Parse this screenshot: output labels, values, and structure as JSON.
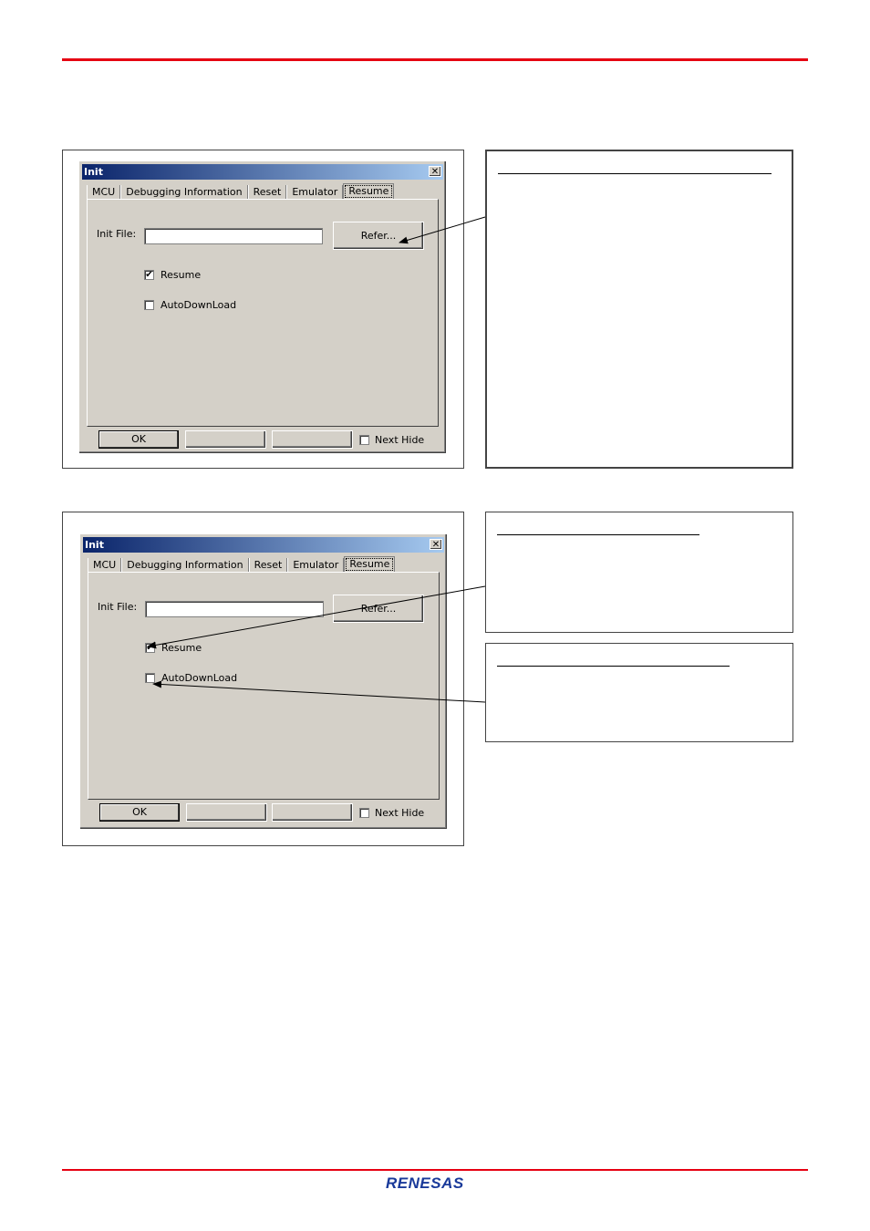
{
  "dialog1": {
    "title": "Init",
    "close_glyph": "✕",
    "tabs": [
      "MCU",
      "Debugging Information",
      "Reset",
      "Emulator",
      "Resume"
    ],
    "init_file_label": "Init File:",
    "init_file_value": "",
    "refer_button": "Refer...",
    "resume_label": "Resume",
    "resume_checked": true,
    "autodownload_label": "AutoDownLoad",
    "autodownload_checked": false,
    "ok_button": "OK",
    "next_hide_label": "Next Hide",
    "next_hide_checked": false
  },
  "dialog2": {
    "title": "Init",
    "close_glyph": "✕",
    "tabs": [
      "MCU",
      "Debugging Information",
      "Reset",
      "Emulator",
      "Resume"
    ],
    "init_file_label": "Init File:",
    "init_file_value": "",
    "refer_button": "Refer...",
    "resume_label": "Resume",
    "resume_checked": true,
    "autodownload_label": "AutoDownLoad",
    "autodownload_checked": false,
    "ok_button": "OK",
    "next_hide_label": "Next Hide",
    "next_hide_checked": false
  },
  "check_glyph": "✔",
  "footer": {
    "logo_text": "RENESAS"
  },
  "colors": {
    "rule": "#e60012",
    "titlebar_start": "#0a246a",
    "titlebar_end": "#a6caf0",
    "dialog_bg": "#d4d0c8",
    "logo": "#1a3a9a"
  }
}
